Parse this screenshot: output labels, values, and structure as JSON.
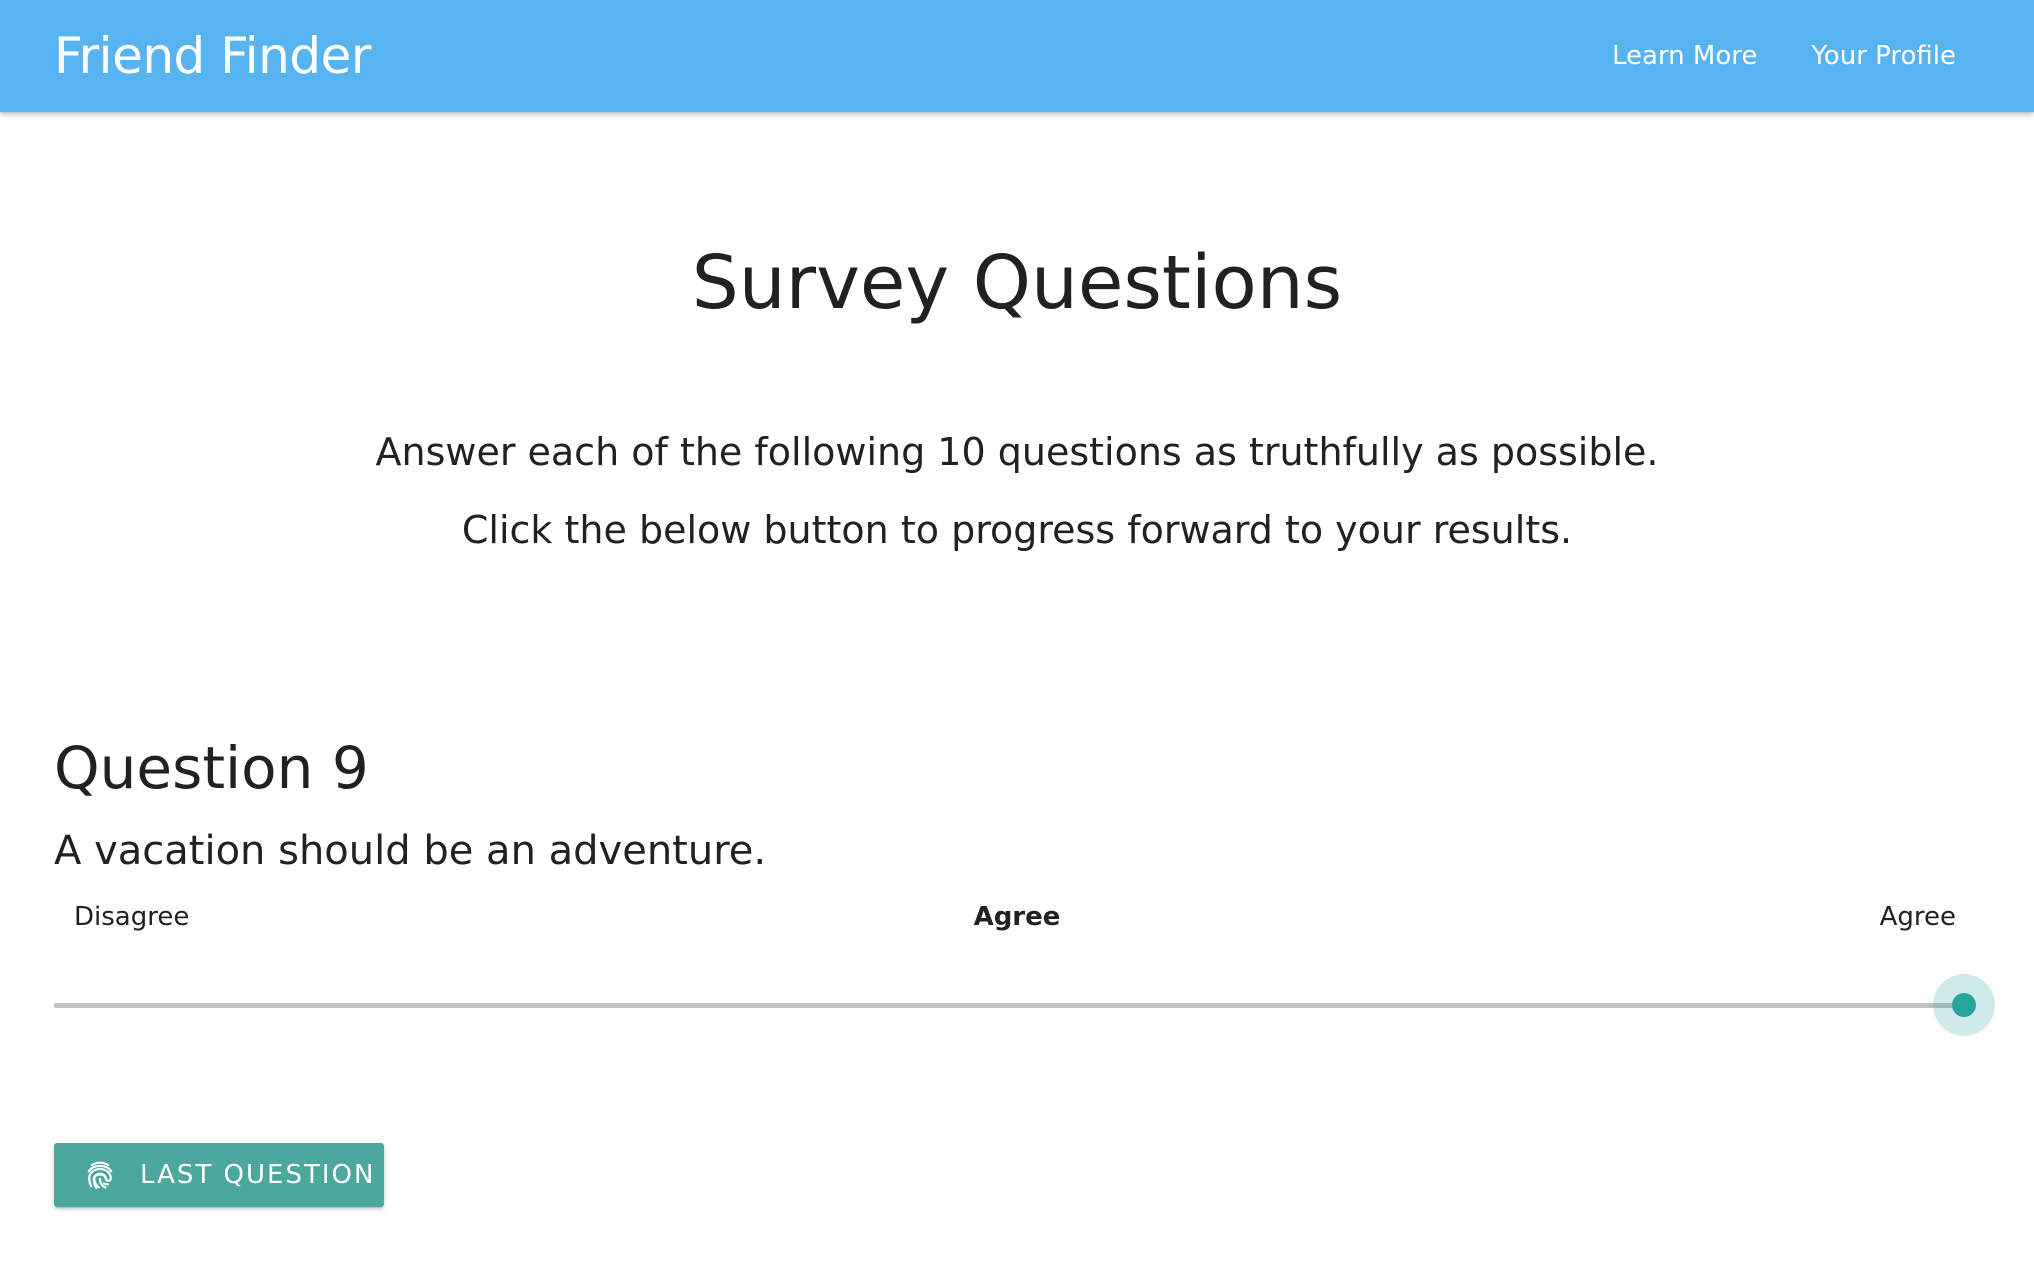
{
  "nav": {
    "brand": "Friend Finder",
    "links": [
      {
        "label": "Learn More"
      },
      {
        "label": "Your Profile"
      }
    ]
  },
  "page": {
    "title": "Survey Questions",
    "intro_line1": "Answer each of the following 10 questions as truthfully as possible.",
    "intro_line2": "Click the below button to progress forward to your results."
  },
  "question": {
    "heading": "Question 9",
    "text": "A vacation should be an adventure.",
    "scale_left": "Disagree",
    "scale_current": "Agree",
    "scale_right": "Agree",
    "slider_value_fraction": 1.0
  },
  "button": {
    "label": "Last Question",
    "icon": "fingerprint-icon"
  },
  "colors": {
    "nav_bg": "#57b4f0",
    "accent": "#26a69a",
    "button_bg": "#4ca89c"
  }
}
